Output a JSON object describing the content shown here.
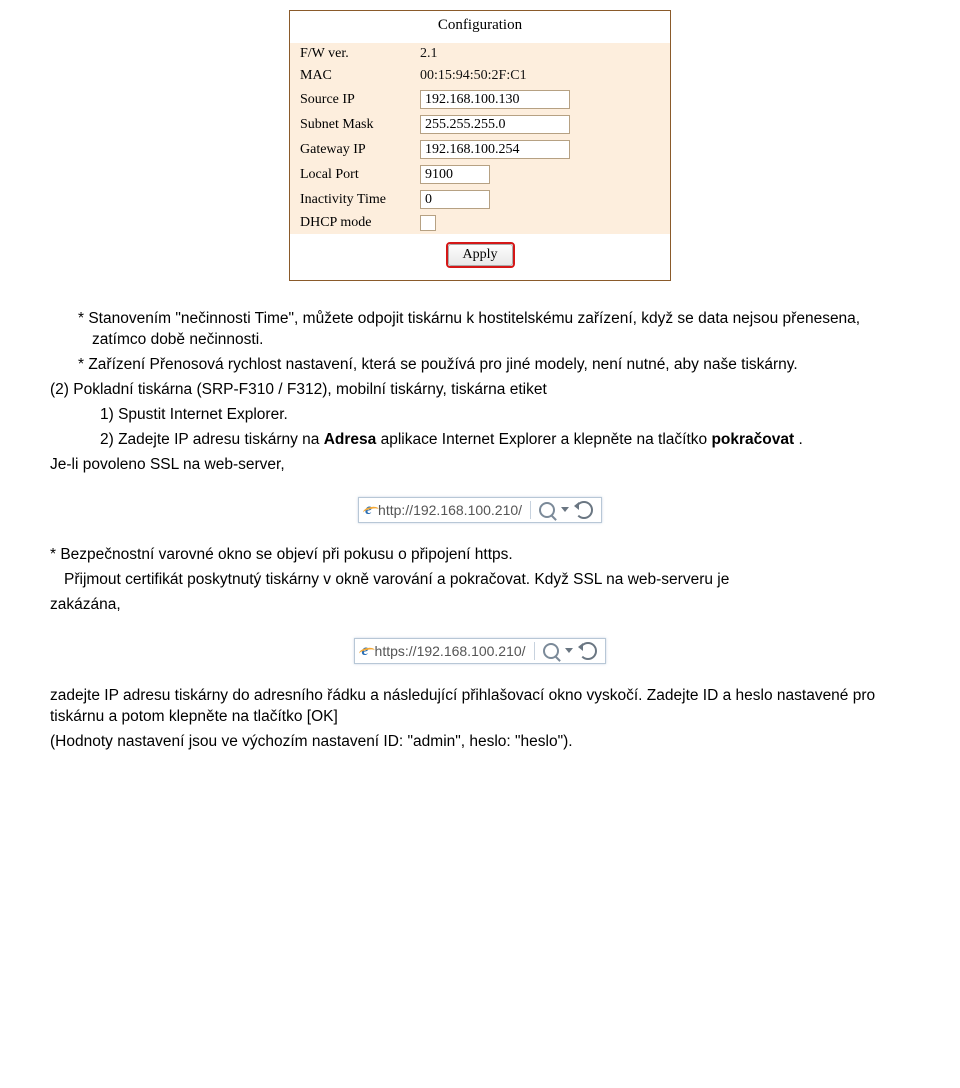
{
  "config_panel": {
    "title": "Configuration",
    "rows": {
      "fw_label": "F/W ver.",
      "fw_val": "2.1",
      "mac_label": "MAC",
      "mac_val": "00:15:94:50:2F:C1",
      "src_label": "Source IP",
      "src_val": "192.168.100.130",
      "mask_label": "Subnet Mask",
      "mask_val": "255.255.255.0",
      "gw_label": "Gateway IP",
      "gw_val": "192.168.100.254",
      "port_label": "Local Port",
      "port_val": "9100",
      "inact_label": "Inactivity Time",
      "inact_val": "0",
      "dhcp_label": "DHCP mode"
    },
    "apply": "Apply"
  },
  "address_bars": {
    "http": "http://192.168.100.210/",
    "https": "https://192.168.100.210/"
  },
  "text": {
    "p1": "* Stanovením \"nečinnosti Time\", můžete odpojit tiskárnu k hostitelskému zařízení, když se data nejsou přenesena, zatímco době nečinnosti.",
    "p2": "* Zařízení Přenosová rychlost nastavení, která se používá pro jiné modely, není nutné, aby naše tiskárny.",
    "p3": "(2) Pokladní tiskárna (SRP-F310 / F312), mobilní tiskárny, tiskárna etiket",
    "p4": "1) Spustit Internet Explorer.",
    "p5a": "2) Zadejte IP adresu tiskárny na ",
    "p5b": "Adresa",
    "p5c": " aplikace Internet Explorer a klepněte na tlačítko ",
    "p5d": "pokračovat",
    "p5e": " .",
    "p6": "Je-li povoleno SSL na web-server,",
    "p7": "* Bezpečnostní varovné okno se objeví při pokusu o připojení https.",
    "p8": "Přijmout certifikát poskytnutý tiskárny v okně varování a pokračovat. Když SSL na web-serveru je",
    "p9": "zakázána,",
    "p10": "zadejte IP adresu tiskárny do adresního řádku a následující přihlašovací okno vyskočí. Zadejte ID a heslo nastavené pro tiskárnu a potom klepněte na tlačítko [OK]",
    "p11": "(Hodnoty nastavení jsou ve výchozím nastavení ID: \"admin\", heslo: \"heslo\")."
  }
}
